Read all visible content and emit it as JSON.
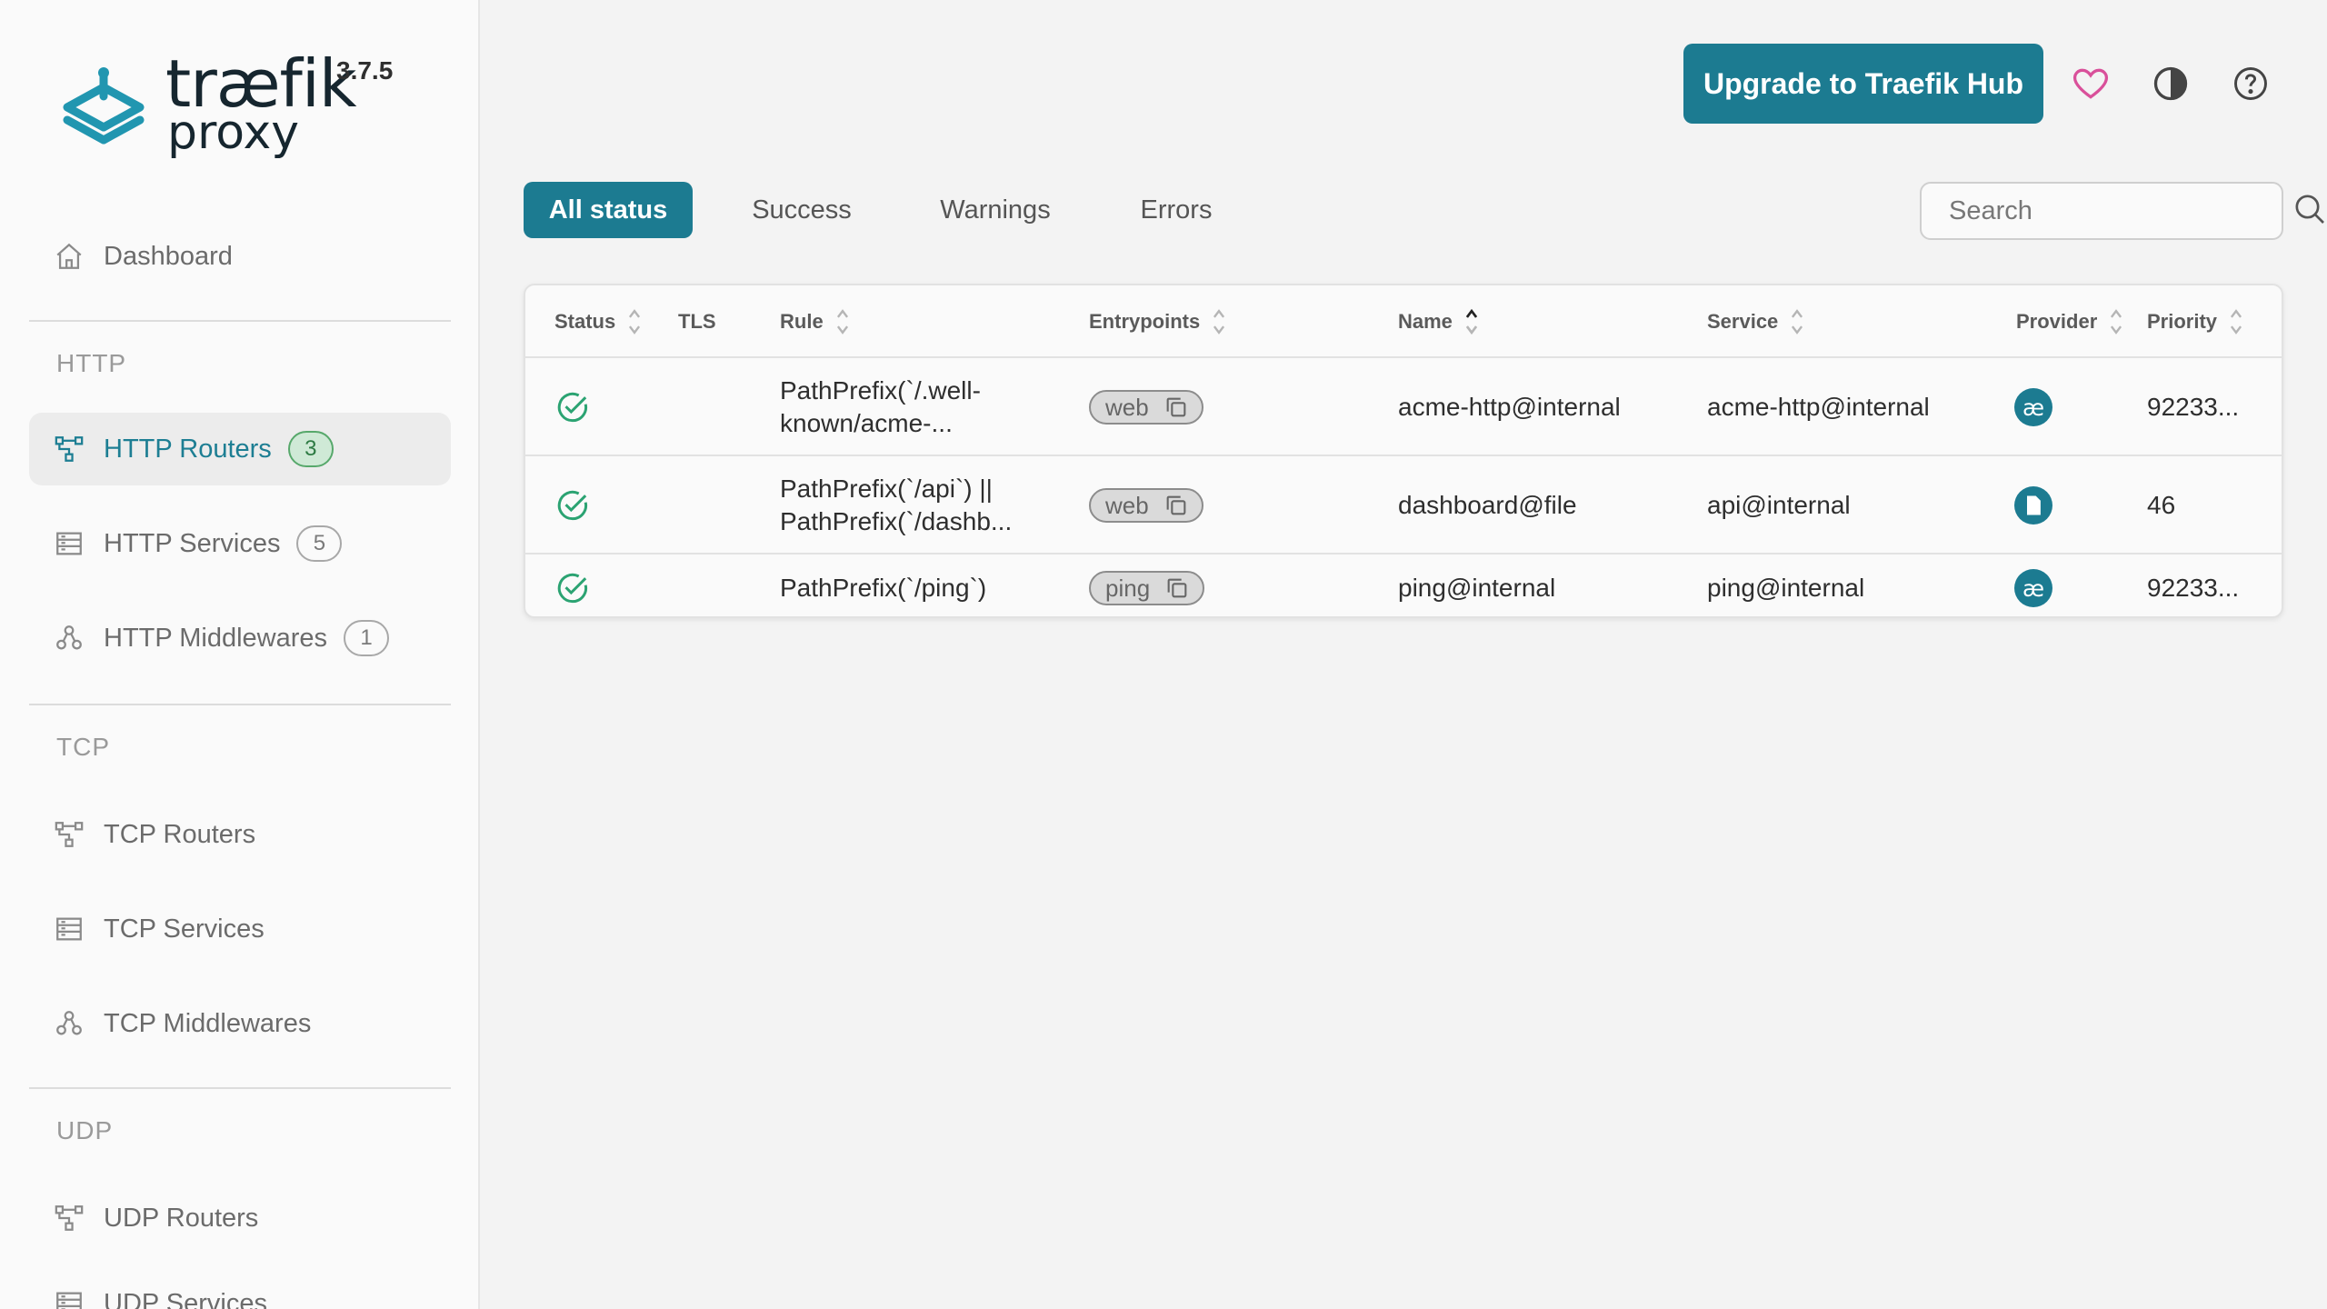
{
  "brand": {
    "name": "træfik",
    "subtitle": "proxy",
    "version": "3.7.5"
  },
  "colors": {
    "accent": "#1c7b91",
    "success": "#2ba372",
    "heart": "#d9509a"
  },
  "sidebar": {
    "dashboard": {
      "label": "Dashboard",
      "icon": "home-icon"
    },
    "sections": [
      {
        "title": "HTTP",
        "items": [
          {
            "label": "HTTP Routers",
            "count": "3",
            "icon": "router-icon",
            "active": true
          },
          {
            "label": "HTTP Services",
            "count": "5",
            "icon": "services-icon"
          },
          {
            "label": "HTTP Middlewares",
            "count": "1",
            "icon": "middleware-icon"
          }
        ]
      },
      {
        "title": "TCP",
        "items": [
          {
            "label": "TCP Routers",
            "icon": "router-icon"
          },
          {
            "label": "TCP Services",
            "icon": "services-icon"
          },
          {
            "label": "TCP Middlewares",
            "icon": "middleware-icon"
          }
        ]
      },
      {
        "title": "UDP",
        "items": [
          {
            "label": "UDP Routers",
            "icon": "router-icon"
          },
          {
            "label": "UDP Services",
            "icon": "services-icon"
          }
        ]
      }
    ]
  },
  "topbar": {
    "upgrade_label": "Upgrade to Traefik Hub",
    "icons": [
      "heart-icon",
      "theme-toggle-icon",
      "help-icon"
    ]
  },
  "filters": {
    "tabs": [
      "All status",
      "Success",
      "Warnings",
      "Errors"
    ],
    "active": "All status",
    "search_placeholder": "Search"
  },
  "table": {
    "columns": [
      "Status",
      "TLS",
      "Rule",
      "Entrypoints",
      "Name",
      "Service",
      "Provider",
      "Priority"
    ],
    "sorted_by": "Name",
    "rows": [
      {
        "status": "success",
        "tls": "",
        "rule": [
          "PathPrefix(`/.well-",
          "known/acme-..."
        ],
        "entrypoint": "web",
        "name": "acme-http@internal",
        "service": "acme-http@internal",
        "provider": "internal",
        "priority": "92233..."
      },
      {
        "status": "success",
        "tls": "",
        "rule": [
          "PathPrefix(`/api`) ||",
          "PathPrefix(`/dashb..."
        ],
        "entrypoint": "web",
        "name": "dashboard@file",
        "service": "api@internal",
        "provider": "file",
        "priority": "46"
      },
      {
        "status": "success",
        "tls": "",
        "rule": [
          "PathPrefix(`/ping`)"
        ],
        "entrypoint": "ping",
        "name": "ping@internal",
        "service": "ping@internal",
        "provider": "internal",
        "priority": "92233..."
      }
    ]
  }
}
